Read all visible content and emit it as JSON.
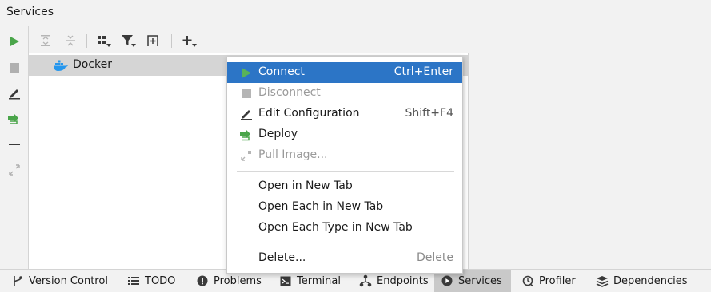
{
  "window": {
    "title": "Services"
  },
  "tree": {
    "item_label": "Docker"
  },
  "context_menu": {
    "items": [
      {
        "label": "Connect",
        "shortcut": "Ctrl+Enter",
        "icon": "play-icon",
        "state": "selected"
      },
      {
        "label": "Disconnect",
        "shortcut": "",
        "icon": "stop-icon",
        "state": "disabled"
      },
      {
        "label": "Edit Configuration",
        "shortcut": "Shift+F4",
        "icon": "pencil-icon",
        "state": "enabled"
      },
      {
        "label": "Deploy",
        "shortcut": "",
        "icon": "deploy-icon",
        "state": "enabled"
      },
      {
        "label": "Pull Image...",
        "shortcut": "",
        "icon": "pull-image-icon",
        "state": "disabled"
      },
      {
        "label": "Open in New Tab",
        "shortcut": "",
        "icon": "",
        "state": "enabled"
      },
      {
        "label": "Open Each in New Tab",
        "shortcut": "",
        "icon": "",
        "state": "enabled"
      },
      {
        "label": "Open Each Type in New Tab",
        "shortcut": "",
        "icon": "",
        "state": "enabled"
      },
      {
        "label": "Delete...",
        "shortcut": "Delete",
        "icon": "",
        "state": "enabled"
      }
    ]
  },
  "bottom_tabs": [
    {
      "label": "Version Control",
      "icon": "branch-icon",
      "active": false
    },
    {
      "label": "TODO",
      "icon": "list-icon",
      "active": false
    },
    {
      "label": "Problems",
      "icon": "alert-icon",
      "active": false
    },
    {
      "label": "Terminal",
      "icon": "terminal-icon",
      "active": false
    },
    {
      "label": "Endpoints",
      "icon": "endpoints-icon",
      "active": false
    },
    {
      "label": "Services",
      "icon": "services-icon",
      "active": true
    },
    {
      "label": "Profiler",
      "icon": "profiler-icon",
      "active": false
    },
    {
      "label": "Dependencies",
      "icon": "dependencies-icon",
      "active": false
    }
  ],
  "colors": {
    "selection": "#2c75c6",
    "run_green": "#4aa54a",
    "tree_selection": "#d5d5d5"
  }
}
